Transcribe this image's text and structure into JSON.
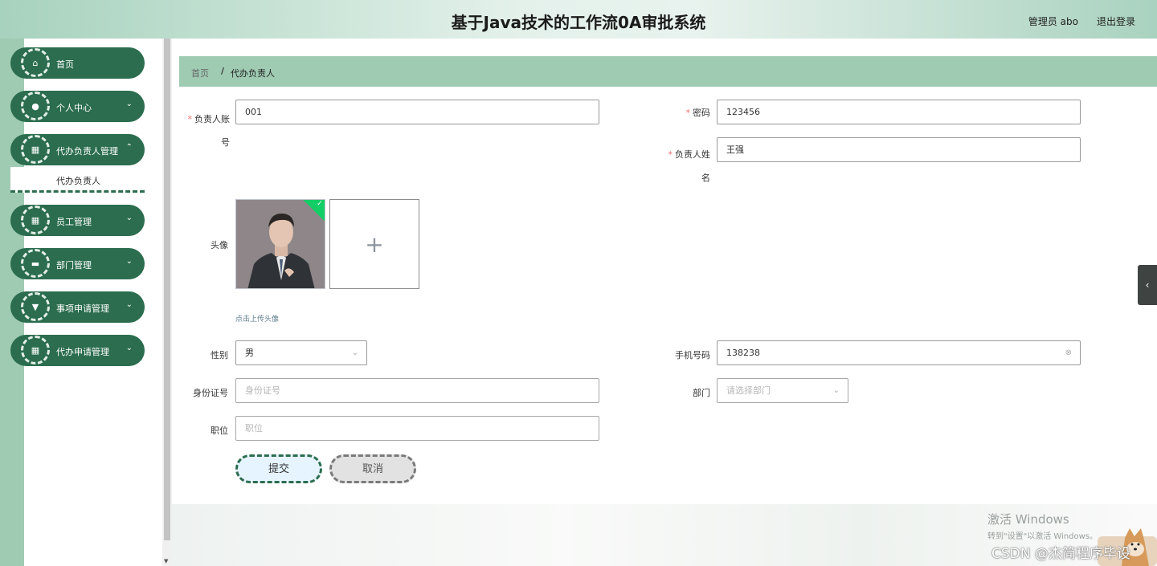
{
  "header": {
    "title": "基于Java技术的工作流0A审批系统",
    "user": "管理员 abo",
    "logout": "退出登录"
  },
  "sidebar": {
    "items": [
      {
        "label": "首页",
        "icon": "home-icon",
        "glyph": "⌂"
      },
      {
        "label": "个人中心",
        "icon": "user-icon",
        "glyph": "●"
      },
      {
        "label": "代办负责人管理",
        "icon": "grid-icon",
        "glyph": "▦"
      },
      {
        "label": "员工管理",
        "icon": "grid-icon",
        "glyph": "▦"
      },
      {
        "label": "部门管理",
        "icon": "monitor-icon",
        "glyph": "▬"
      },
      {
        "label": "事项申请管理",
        "icon": "pin-icon",
        "glyph": "▼"
      },
      {
        "label": "代办申请管理",
        "icon": "grid-icon",
        "glyph": "▦"
      }
    ],
    "submenu_active": "代办负责人"
  },
  "breadcrumb": {
    "home": "首页",
    "separator": "/",
    "current": "代办负责人"
  },
  "form": {
    "account_label": "负责人账号",
    "account_value": "001",
    "password_label": "密码",
    "password_value": "123456",
    "name_label": "负责人姓名",
    "name_value": "王强",
    "avatar_label": "头像",
    "upload_tip": "点击上传头像",
    "gender_label": "性别",
    "gender_value": "男",
    "phone_label": "手机号码",
    "phone_value": "138238",
    "idcard_label": "身份证号",
    "idcard_placeholder": "身份证号",
    "dept_label": "部门",
    "dept_placeholder": "请选择部门",
    "position_label": "职位",
    "position_placeholder": "职位",
    "submit": "提交",
    "cancel": "取消"
  },
  "overlay": {
    "win_line1": "激活 Windows",
    "win_line2": "转到\"设置\"以激活 Windows。",
    "csdn": "CSDN @杰简程序毕设"
  },
  "colors": {
    "menu_green": "#2b6d4e",
    "breadcrumb_bg": "#9fcbb3",
    "required": "#f56c6c"
  }
}
